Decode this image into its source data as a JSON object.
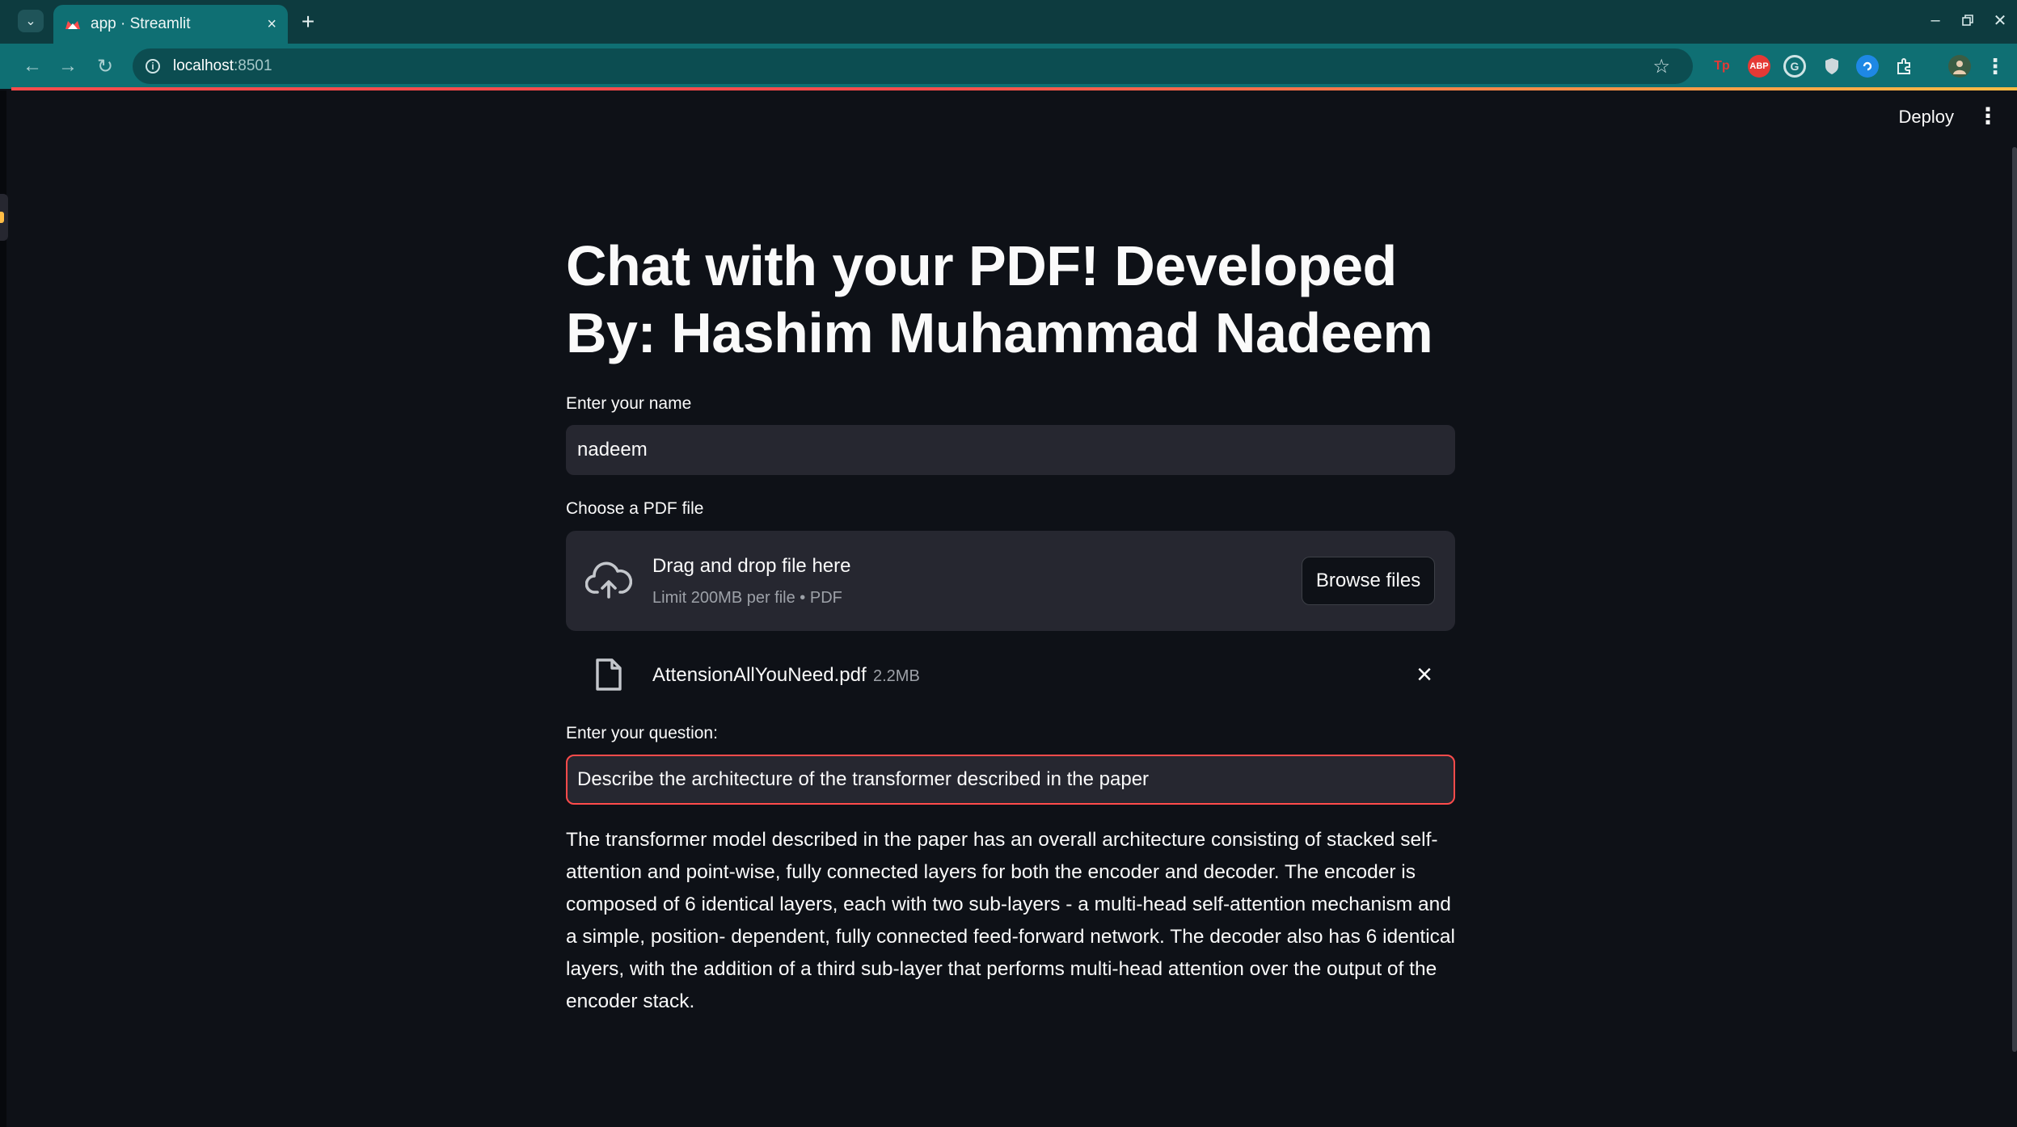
{
  "browser": {
    "tab_title": "app · Streamlit",
    "tab_close": "×",
    "new_tab": "+",
    "address_host": "localhost",
    "address_port": ":8501",
    "window_controls": [
      "minimize-icon",
      "restore-icon",
      "close-icon"
    ],
    "extensions": [
      {
        "name": "extension-tp-icon",
        "label": "Tp",
        "color": "#e53935"
      },
      {
        "name": "extension-adblock-icon",
        "label": "ABP",
        "color": "#e53935"
      },
      {
        "name": "extension-grammarly-icon",
        "label": "G",
        "color": "#1f8f7a"
      },
      {
        "name": "extension-shield-icon",
        "label": "",
        "color": "#cfd8dc"
      },
      {
        "name": "extension-blue-icon",
        "label": "",
        "color": "#1e88e5"
      }
    ]
  },
  "header": {
    "deploy_label": "Deploy",
    "menu_icon": "kebab-menu-icon"
  },
  "main": {
    "title": "Chat with your PDF! Developed By: Hashim Muhammad Nadeem",
    "name_label": "Enter your name",
    "name_value": "nadeem",
    "uploader_label": "Choose a PDF file",
    "dropzone_main": "Drag and drop file here",
    "dropzone_sub": "Limit 200MB per file • PDF",
    "browse_label": "Browse files",
    "uploaded_file": {
      "name": "AttensionAllYouNeed.pdf",
      "size": "2.2MB"
    },
    "question_label": "Enter your question:",
    "question_value": "Describe the architecture of the transformer described in the paper",
    "answer": "The transformer model described in the paper has an overall architecture consisting of stacked self-attention and point-wise, fully connected layers for both the encoder and decoder. The encoder is composed of 6 identical layers, each with two sub-layers - a multi-head self-attention mechanism and a simple, position- dependent, fully connected feed-forward network. The decoder also has 6 identical layers, with the addition of a third sub-layer that performs multi-head attention over the output of the encoder stack."
  },
  "colors": {
    "background": "#0e1117",
    "input_bg": "#262730",
    "accent": "#ff4b4b",
    "browser_frame": "#0f6f73"
  }
}
